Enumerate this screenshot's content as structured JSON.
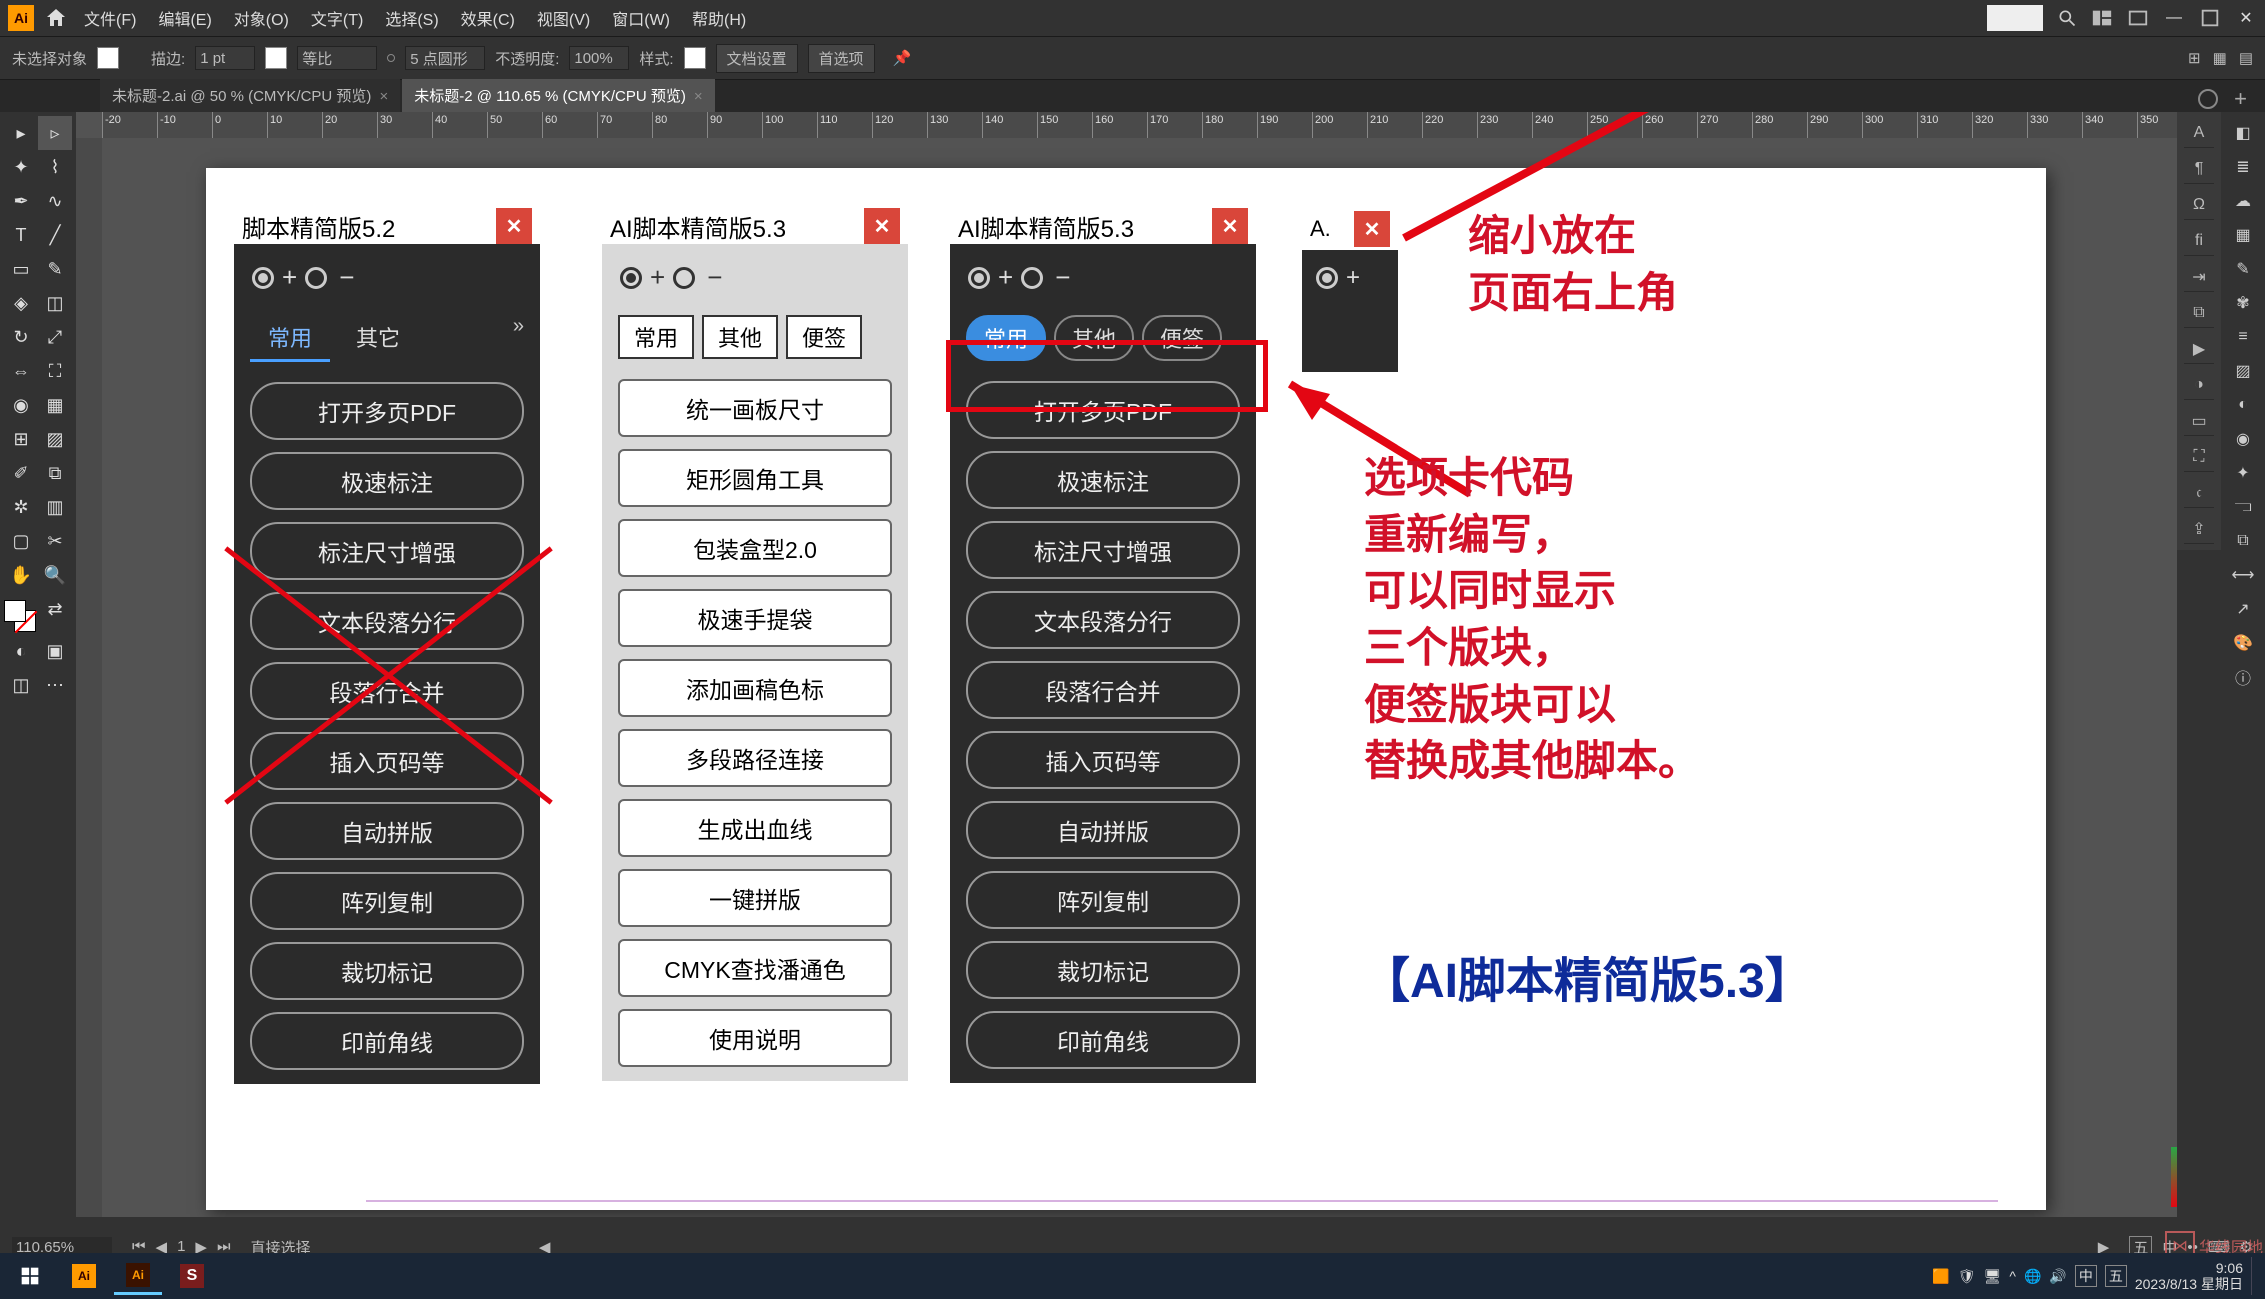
{
  "menubar": {
    "items": [
      "文件(F)",
      "编辑(E)",
      "对象(O)",
      "文字(T)",
      "选择(S)",
      "效果(C)",
      "视图(V)",
      "窗口(W)",
      "帮助(H)"
    ]
  },
  "propbar": {
    "noselection": "未选择对象",
    "stroke_label": "描边:",
    "stroke_val": "1 pt",
    "uniform": "等比",
    "brush_label": "5 点圆形",
    "opacity_label": "不透明度:",
    "opacity_val": "100%",
    "style_label": "样式:",
    "docsetup": "文档设置",
    "prefs": "首选项"
  },
  "tabsrow": {
    "tabs": [
      {
        "label": "未标题-2.ai @ 50 % (CMYK/CPU 预览)"
      },
      {
        "label": "未标题-2 @ 110.65 % (CMYK/CPU 预览)"
      }
    ]
  },
  "ruler_start": -20,
  "ruler_step": 10,
  "panelA": {
    "title": "脚本精简版5.2",
    "tabs": [
      "常用",
      "其它"
    ],
    "buttons": [
      "打开多页PDF",
      "极速标注",
      "标注尺寸增强",
      "文本段落分行",
      "段落行合并",
      "插入页码等",
      "自动拼版",
      "阵列复制",
      "裁切标记",
      "印前角线"
    ]
  },
  "panelB": {
    "title": "AI脚本精简版5.3",
    "tabs": [
      "常用",
      "其他",
      "便签"
    ],
    "buttons": [
      "统一画板尺寸",
      "矩形圆角工具",
      "包装盒型2.0",
      "极速手提袋",
      "添加画稿色标",
      "多段路径连接",
      "生成出血线",
      "一键拼版",
      "CMYK查找潘通色",
      "使用说明"
    ]
  },
  "panelC": {
    "title": "AI脚本精简版5.3",
    "tabs": [
      "常用",
      "其他",
      "便签"
    ],
    "buttons": [
      "打开多页PDF",
      "极速标注",
      "标注尺寸增强",
      "文本段落分行",
      "段落行合并",
      "插入页码等",
      "自动拼版",
      "阵列复制",
      "裁切标记",
      "印前角线"
    ]
  },
  "panelD": {
    "title": "A."
  },
  "annotations": {
    "top": "缩小放在\n页面右上角",
    "mid": "选项卡代码\n重新编写，\n可以同时显示\n三个版块，\n便签版块可以\n替换成其他脚本。",
    "bottom": "【AI脚本精简版5.3】"
  },
  "statusbar": {
    "zoom": "110.65%",
    "page": "1",
    "tool": "直接选择"
  },
  "taskbar": {
    "time": "9:06",
    "date": "2023/8/13",
    "day": "星期日"
  },
  "watermark": "华线园地"
}
